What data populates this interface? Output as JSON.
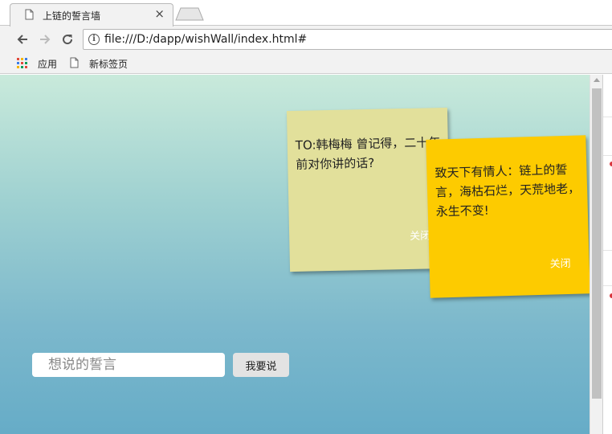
{
  "browser": {
    "tab": {
      "title": "上链的誓言墙",
      "close_glyph": "×"
    },
    "address_bar": {
      "url": "file:///D:/dapp/wishWall/index.html#"
    },
    "bookmarks": [
      {
        "label": "应用",
        "icon": "apps-grid-icon"
      },
      {
        "label": "新标签页",
        "icon": "page-icon"
      }
    ]
  },
  "page": {
    "notes": [
      {
        "text": "TO:韩梅梅 曾记得，二十年前对你讲的话?",
        "close_label": "关闭",
        "color": "#e2e09b"
      },
      {
        "text": "致天下有情人：链上的誓言，海枯石烂，天荒地老，永生不变!",
        "close_label": "关闭",
        "color": "#fdcb00"
      }
    ],
    "input": {
      "placeholder": "想说的誓言",
      "value": ""
    },
    "submit_label": "我要说"
  },
  "colors": {
    "background_top": "#c9eadb",
    "background_bottom": "#66acc7",
    "note_close_text": "#ffffff"
  }
}
